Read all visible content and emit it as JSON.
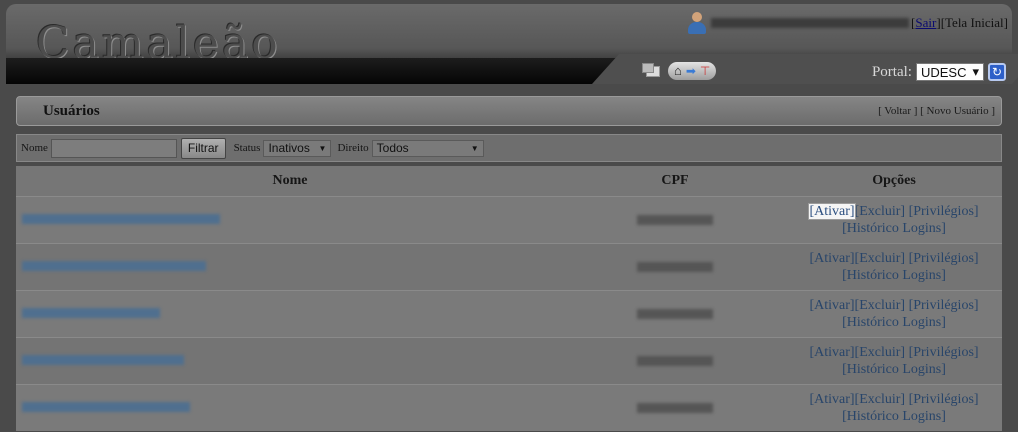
{
  "header": {
    "logo": "Camaleão",
    "sair": "Sair",
    "tela_inicial": "[Tela Inicial]",
    "portal_label": "Portal:",
    "portal_value": "UDESC"
  },
  "panel": {
    "title": "Usuários",
    "links": "[ Voltar ] [ Novo Usuário ]"
  },
  "filters": {
    "nome_label": "Nome",
    "filtrar": "Filtrar",
    "status_label": "Status",
    "status_value": "Inativos",
    "direito_label": "Direito",
    "direito_value": "Todos"
  },
  "table": {
    "headers": [
      "Nome",
      "CPF",
      "Opções"
    ],
    "option_ativar": "[Ativar]",
    "option_excluir": "[Excluir]",
    "option_privilegios": "[Privilégios]",
    "option_historico": "[Histórico Logins]"
  }
}
